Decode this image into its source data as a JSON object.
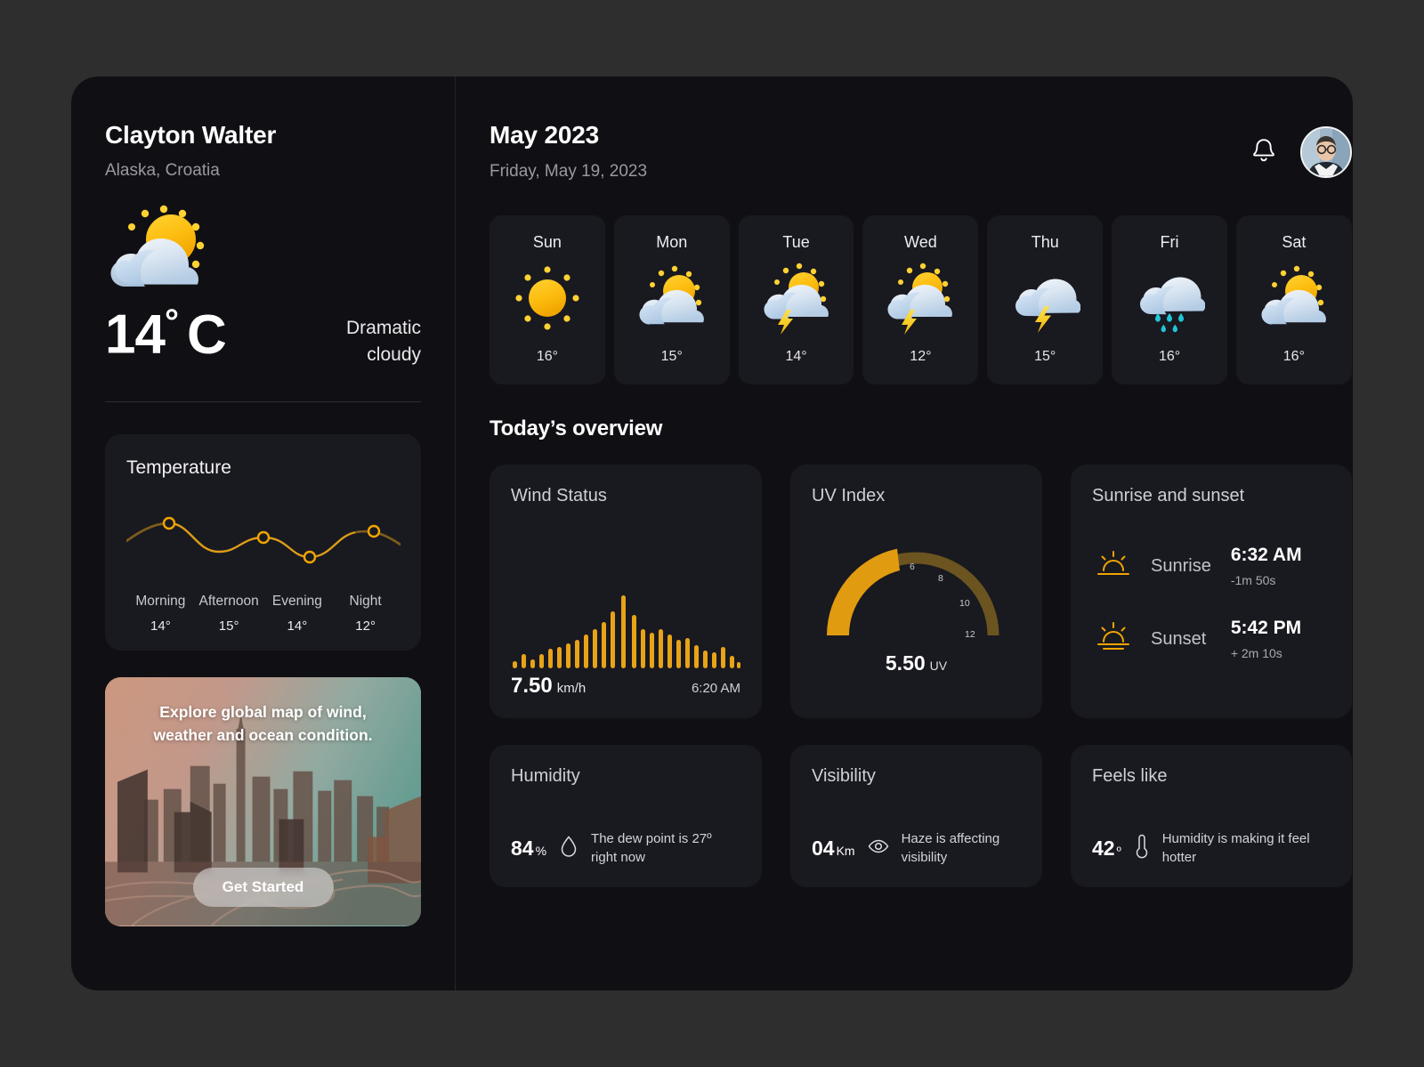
{
  "sidebar": {
    "user_name": "Clayton Walter",
    "location": "Alaska, Croatia",
    "current_icon": "sun-cloud-icon",
    "temperature": "14",
    "degree_symbol": "°",
    "unit": "C",
    "condition": "Dramatic cloudy",
    "temp_card": {
      "title": "Temperature",
      "points": [
        {
          "label": "Morning",
          "value": "14°"
        },
        {
          "label": "Afternoon",
          "value": "15°"
        },
        {
          "label": "Evening",
          "value": "14°"
        },
        {
          "label": "Night",
          "value": "12°"
        }
      ]
    },
    "promo": {
      "text": "Explore global map of wind, weather and ocean condition.",
      "button": "Get Started"
    }
  },
  "header": {
    "month": "May 2023",
    "full_date": "Friday, May 19, 2023",
    "bell_icon": "bell-icon",
    "avatar": "user-avatar"
  },
  "week": [
    {
      "day": "Sun",
      "icon": "sun-icon",
      "temp": "16°"
    },
    {
      "day": "Mon",
      "icon": "sun-cloud-icon",
      "temp": "15°"
    },
    {
      "day": "Tue",
      "icon": "sun-cloud-lightning-icon",
      "temp": "14°"
    },
    {
      "day": "Wed",
      "icon": "sun-cloud-lightning-icon",
      "temp": "12°"
    },
    {
      "day": "Thu",
      "icon": "cloud-lightning-icon",
      "temp": "15°"
    },
    {
      "day": "Fri",
      "icon": "cloud-rain-icon",
      "temp": "16°"
    },
    {
      "day": "Sat",
      "icon": "sun-cloud-icon",
      "temp": "16°"
    }
  ],
  "overview": {
    "title": "Today’s overview",
    "wind": {
      "title": "Wind Status",
      "value": "7.50",
      "unit": "km/h",
      "time": "6:20 AM"
    },
    "uv": {
      "title": "UV Index",
      "value": "5.50",
      "unit": "UV",
      "ticks": [
        "6",
        "8",
        "10",
        "12"
      ]
    },
    "sun": {
      "title": "Sunrise and sunset",
      "rows": [
        {
          "icon": "sunrise-icon",
          "label": "Sunrise",
          "time": "6:32 AM",
          "delta": "-1m 50s"
        },
        {
          "icon": "sunset-icon",
          "label": "Sunset",
          "time": "5:42 PM",
          "delta": "+ 2m 10s"
        }
      ]
    },
    "humidity": {
      "title": "Humidity",
      "value": "84",
      "unit": "%",
      "icon": "droplet-icon",
      "note": "The dew point is 27º right now"
    },
    "visibility": {
      "title": "Visibility",
      "value": "04",
      "unit": "Km",
      "icon": "eye-icon",
      "note": "Haze is affecting visibility"
    },
    "feels": {
      "title": "Feels like",
      "value": "42",
      "unit": "º",
      "icon": "thermometer-icon",
      "note": "Humidity is making it feel hotter"
    }
  },
  "colors": {
    "accent": "#E8A317",
    "accent_dark": "#6b5420",
    "page_bg": "#2e2e2e",
    "panel_bg": "#101014",
    "card_bg": "#191920"
  },
  "chart_data": [
    {
      "type": "line",
      "title": "Temperature",
      "categories": [
        "Morning",
        "Afternoon",
        "Evening",
        "Night"
      ],
      "values": [
        14,
        15,
        14,
        12
      ],
      "ylabel": "",
      "xlabel": "",
      "ylim": [
        11,
        16
      ],
      "grid": false,
      "legend": "none",
      "series_color": "#E8A317"
    },
    {
      "type": "bar",
      "title": "Wind Status",
      "xlabel": "",
      "ylabel": "",
      "categories": [
        "1",
        "2",
        "3",
        "4",
        "5",
        "6",
        "7",
        "8",
        "9",
        "10",
        "11",
        "12",
        "13",
        "14",
        "15",
        "16",
        "17",
        "18",
        "19",
        "20",
        "21",
        "22",
        "23",
        "24",
        "25",
        "26"
      ],
      "values": [
        4,
        12,
        6,
        12,
        18,
        20,
        24,
        28,
        34,
        40,
        48,
        58,
        76,
        54,
        40,
        36,
        40,
        34,
        28,
        30,
        22,
        16,
        14,
        20,
        10,
        5
      ],
      "annotation_value": "7.50 km/h",
      "annotation_time": "6:20 AM",
      "ylim": [
        0,
        80
      ],
      "grid": false
    },
    {
      "type": "gauge",
      "title": "UV Index",
      "value": 5.5,
      "range": [
        0,
        13
      ],
      "ticks": [
        6,
        8,
        10,
        12
      ],
      "display_value": "5.50 UV",
      "arc_color": "#E09B10",
      "track_color": "#6b5420"
    }
  ]
}
